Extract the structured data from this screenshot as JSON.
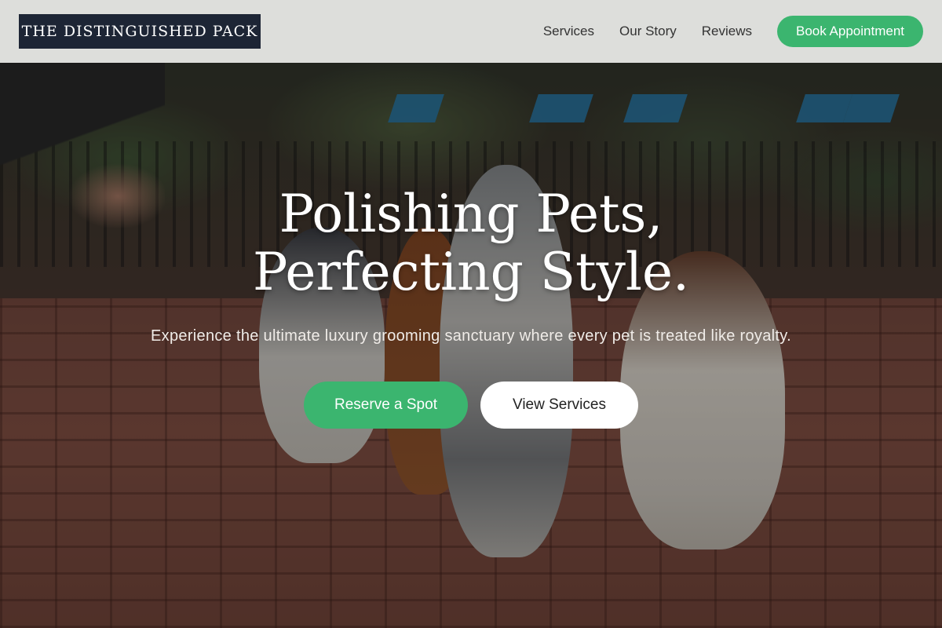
{
  "brand": {
    "name": "THE DISTINGUISHED PACK"
  },
  "nav": {
    "items": [
      {
        "label": "Services"
      },
      {
        "label": "Our Story"
      },
      {
        "label": "Reviews"
      }
    ],
    "cta_label": "Book Appointment"
  },
  "hero": {
    "title": "Polishing Pets, Perfecting Style.",
    "subtitle": "Experience the ultimate luxury grooming sanctuary where every pet is treated like royalty.",
    "primary_label": "Reserve a Spot",
    "secondary_label": "View Services"
  },
  "colors": {
    "accent": "#3bb56f",
    "logo_bg": "#1d2535",
    "header_bg": "#eeeeec"
  }
}
